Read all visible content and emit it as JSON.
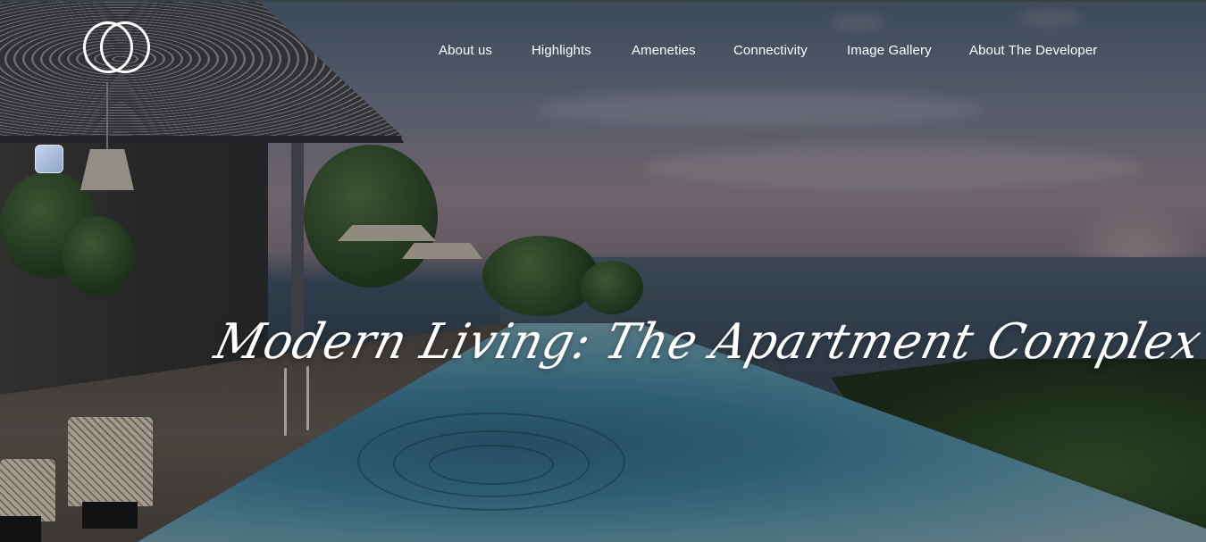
{
  "logo": {
    "icon": "double-ring-logo-icon"
  },
  "nav": {
    "items": [
      {
        "label": "About us"
      },
      {
        "label": "Highlights"
      },
      {
        "label": "Ameneties"
      },
      {
        "label": "Connectivity"
      },
      {
        "label": "Image Gallery"
      },
      {
        "label": "About The Developer"
      }
    ]
  },
  "hero": {
    "headline": "Modern Living: The Apartment Complex",
    "image": "rooftop-infinity-pool-sea-view",
    "colors": {
      "text": "#ffffff",
      "sky": "#6a7184",
      "pool": "#3a7590"
    }
  },
  "floating_widget": {
    "icon": "window-thumbnail-icon"
  }
}
